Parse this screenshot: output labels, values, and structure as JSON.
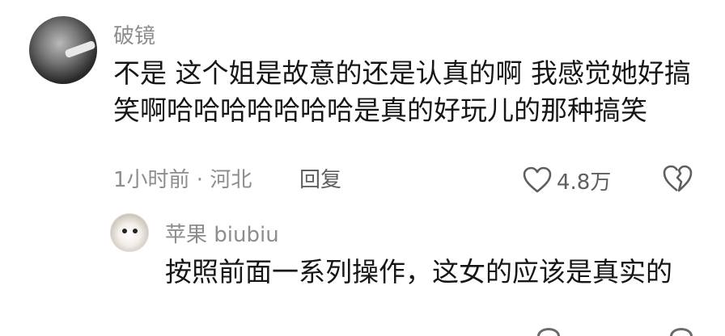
{
  "comment": {
    "username": "破镜",
    "text": "不是 这个姐是故意的还是认真的啊 我感觉她好搞笑啊哈哈哈哈哈哈哈是真的好玩儿的那种搞笑",
    "time_location": "1小时前 · 河北",
    "reply_label": "回复",
    "like_count": "4.8万",
    "icons": {
      "like": "heart-outline-icon",
      "dislike": "broken-heart-icon"
    }
  },
  "reply": {
    "username": "苹果 biubiu",
    "text": "按照前面一系列操作，这女的应该是真实的"
  },
  "colors": {
    "primary_text": "#161616",
    "secondary_text": "#8d8d8d",
    "icon": "#5f5f5f"
  }
}
